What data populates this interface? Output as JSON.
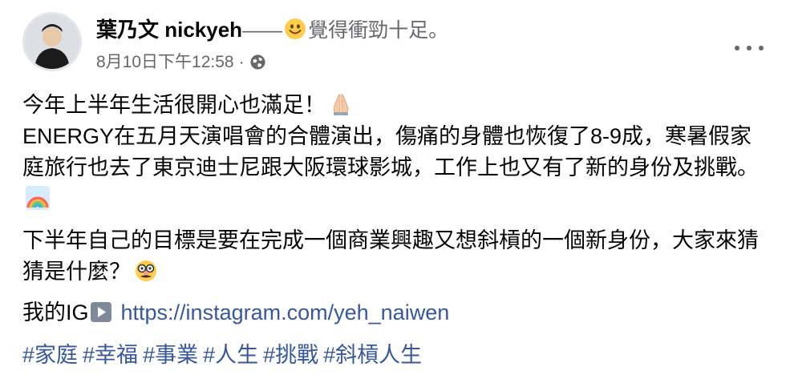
{
  "author": {
    "name": "葉乃文 nickyeh",
    "status_prefix": "——",
    "status_icon": "smiley-face-icon",
    "status_text": "覺得衝勁十足。"
  },
  "meta": {
    "timestamp": "8月10日下午12:58",
    "separator": "·",
    "audience_icon": "globe-icon"
  },
  "post": {
    "line1": "今年上半年生活很開心也滿足！",
    "line1_emoji": "folded-hands-icon",
    "para1": "ENERGY在五月天演唱會的合體演出，傷痛的身體也恢復了8-9成，寒暑假家庭旅行也去了東京迪士尼跟大阪環球影城，工作上也又有了新的身份及挑戰。",
    "para1_emoji": "rainbow-icon",
    "para2": "下半年自己的目標是要在完成一個商業興趣又想斜槓的一個新身份，大家來猜猜是什麼？",
    "para2_emoji": "disguised-face-icon",
    "ig_label": "我的IG",
    "ig_icon": "play-button-icon",
    "ig_link": "https://instagram.com/yeh_naiwen",
    "hashtags": [
      "#家庭",
      "#幸福",
      "#事業",
      "#人生",
      "#挑戰",
      "#斜槓人生"
    ]
  },
  "colors": {
    "text": "#050505",
    "secondary": "#65676b",
    "link": "#385898"
  }
}
